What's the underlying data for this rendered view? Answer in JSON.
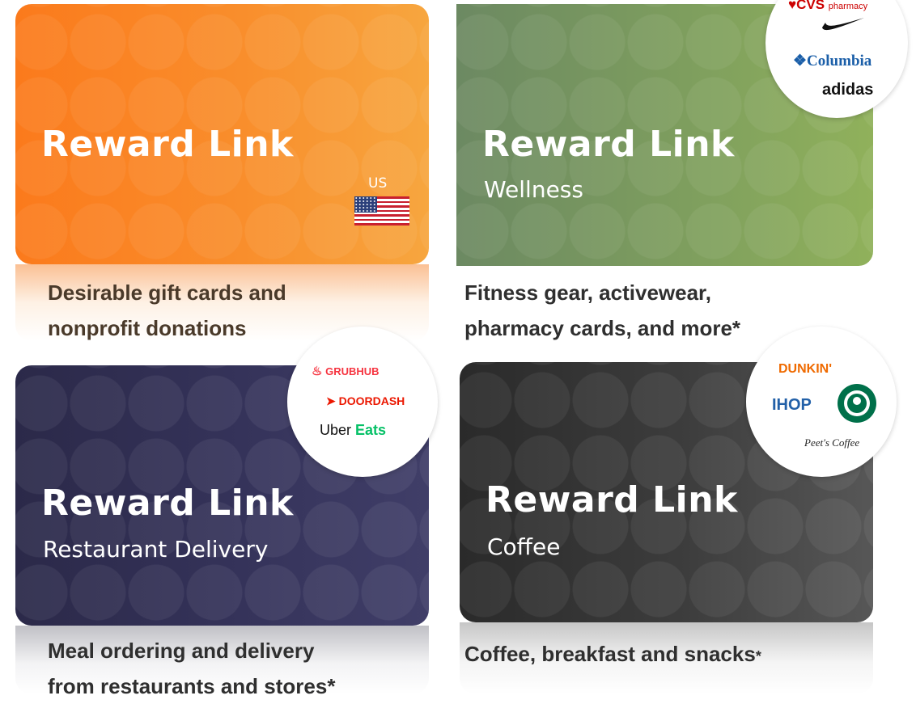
{
  "cards": [
    {
      "title": "Reward Link",
      "subtitle": "",
      "region_label": "US",
      "caption": [
        "Desirable gift cards and",
        "nonprofit donations"
      ],
      "colors": {
        "start": "#fb7b1c",
        "end": "#f7a63f",
        "caption": "#4a3a2a"
      }
    },
    {
      "title": "Reward Link",
      "subtitle": "Wellness",
      "caption": [
        "Fitness gear, activewear,",
        "pharmacy cards, and more*"
      ],
      "brands": {
        "cvs": "CVS",
        "cvs_sub": "pharmacy",
        "nike": "swoosh",
        "columbia": "Columbia",
        "adidas": "adidas"
      },
      "colors": {
        "start": "#6f8c64",
        "end": "#8fb05c",
        "caption": "#2f2f2f"
      }
    },
    {
      "title": "Reward Link",
      "subtitle": "Restaurant Delivery",
      "caption": [
        "Meal ordering and delivery",
        "from restaurants and stores*"
      ],
      "brands": {
        "grubhub": "GRUBHUB",
        "doordash": "DOORDASH",
        "uber": "Uber",
        "eats": "Eats"
      },
      "colors": {
        "start": "#2c2a4a",
        "end": "#3f3d66",
        "caption": "#2f2f2f"
      }
    },
    {
      "title": "Reward Link",
      "subtitle": "Coffee",
      "caption": [
        "Coffee, breakfast and snacks",
        "*"
      ],
      "brands": {
        "dunkin": "DUNKIN'",
        "ihop": "IHOP",
        "peets": "Peet's Coffee"
      },
      "colors": {
        "start": "#2a2a2a",
        "end": "#555555",
        "caption": "#2f2f2f"
      }
    }
  ]
}
